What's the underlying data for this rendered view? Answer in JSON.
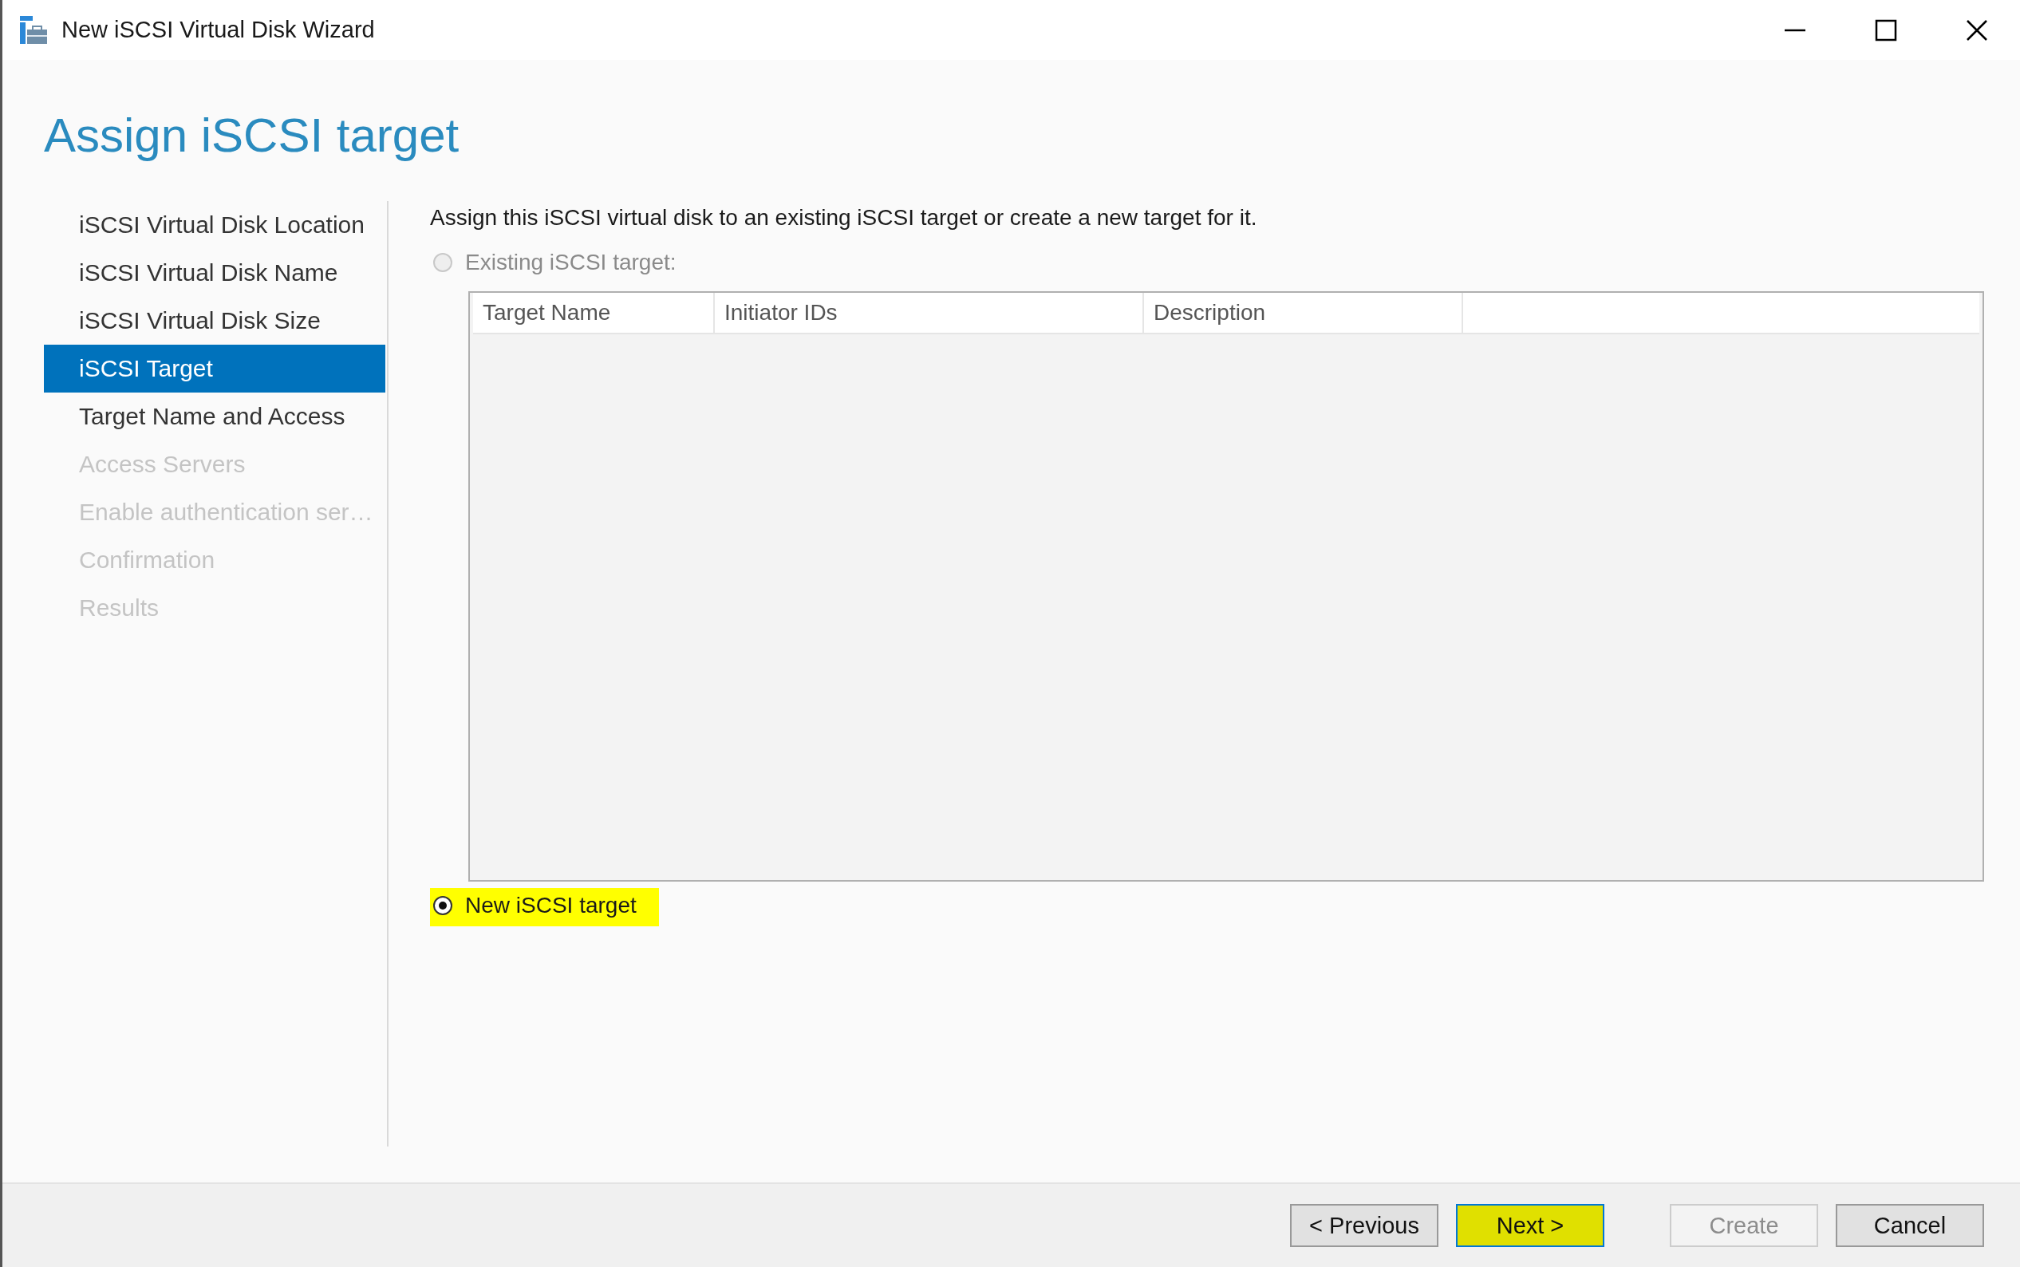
{
  "window": {
    "title": "New iSCSI Virtual Disk Wizard"
  },
  "heading": "Assign iSCSI target",
  "sidebar": {
    "items": [
      {
        "label": "iSCSI Virtual Disk Location",
        "selected": false,
        "disabled": false
      },
      {
        "label": "iSCSI Virtual Disk Name",
        "selected": false,
        "disabled": false
      },
      {
        "label": "iSCSI Virtual Disk Size",
        "selected": false,
        "disabled": false
      },
      {
        "label": "iSCSI Target",
        "selected": true,
        "disabled": false
      },
      {
        "label": "Target Name and Access",
        "selected": false,
        "disabled": false
      },
      {
        "label": "Access Servers",
        "selected": false,
        "disabled": true
      },
      {
        "label": "Enable authentication ser…",
        "selected": false,
        "disabled": true
      },
      {
        "label": "Confirmation",
        "selected": false,
        "disabled": true
      },
      {
        "label": "Results",
        "selected": false,
        "disabled": true
      }
    ]
  },
  "instruction": "Assign this iSCSI virtual disk to an existing iSCSI target or create a new target for it.",
  "options": [
    {
      "label": "Existing iSCSI target:",
      "selected": false,
      "disabled": true,
      "highlighted": false
    },
    {
      "label": "New iSCSI target",
      "selected": true,
      "disabled": false,
      "highlighted": true
    }
  ],
  "table": {
    "columns": [
      "Target Name",
      "Initiator IDs",
      "Description"
    ]
  },
  "buttons": [
    {
      "label": "< Previous",
      "disabled": false,
      "highlighted": false
    },
    {
      "label": "Next >",
      "disabled": false,
      "highlighted": true
    },
    {
      "label": "Create",
      "disabled": true,
      "highlighted": false
    },
    {
      "label": "Cancel",
      "disabled": false,
      "highlighted": false
    }
  ]
}
